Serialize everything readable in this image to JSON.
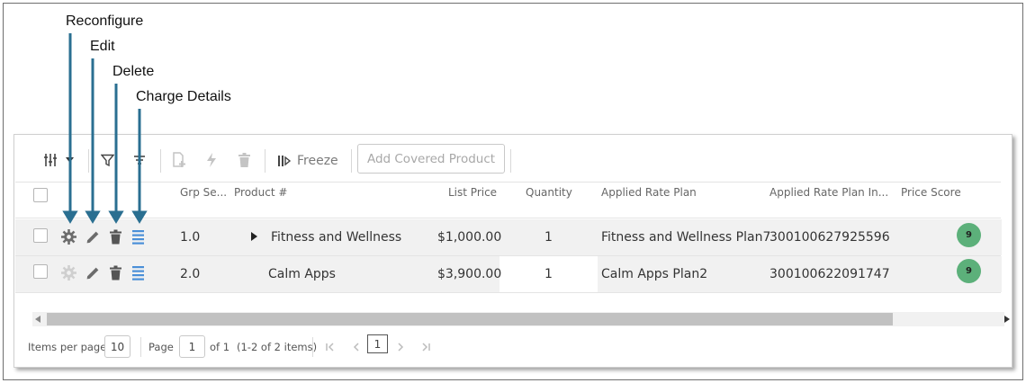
{
  "callouts": {
    "reconfigure": "Reconfigure",
    "edit": "Edit",
    "delete": "Delete",
    "charge_details": "Charge Details"
  },
  "toolbar": {
    "freeze_label": "Freeze",
    "add_covered_label": "Add Covered Product"
  },
  "columns": {
    "grp_seq": "Grp Se...",
    "product": "Product #",
    "list_price": "List Price",
    "quantity": "Quantity",
    "applied_rate_plan": "Applied Rate Plan",
    "applied_rate_plan_id": "Applied Rate Plan In...",
    "price_score": "Price Score"
  },
  "rows": [
    {
      "grp_seq": "1.0",
      "product": "Fitness and Wellness",
      "list_price": "$1,000.00",
      "quantity": "1",
      "applied_rate_plan": "Fitness and Wellness Plan7",
      "applied_rate_plan_id": "300100627925596",
      "price_score": "9"
    },
    {
      "grp_seq": "2.0",
      "product": "Calm Apps",
      "list_price": "$3,900.00",
      "quantity": "1",
      "applied_rate_plan": "Calm Apps Plan2",
      "applied_rate_plan_id": "300100622091747",
      "price_score": "9"
    }
  ],
  "pagination": {
    "items_per_page_label": "Items per page:",
    "items_per_page_value": "10",
    "page_label": "Page",
    "page_value": "1",
    "of_label": "of 1",
    "range_label": "(1-2 of 2 items)",
    "current_page": "1"
  },
  "colors": {
    "price_score_badge": "#5cb07a",
    "charge_details_icon": "#4a8fd8",
    "callout_arrow": "#2a6f91"
  },
  "icons": [
    "settings-icon",
    "filter-icon",
    "sort-icon",
    "add-product-icon",
    "flash-icon",
    "trash-icon",
    "freeze-icon",
    "gear-icon",
    "pencil-icon",
    "charge-details-icon",
    "caret-right-icon"
  ]
}
